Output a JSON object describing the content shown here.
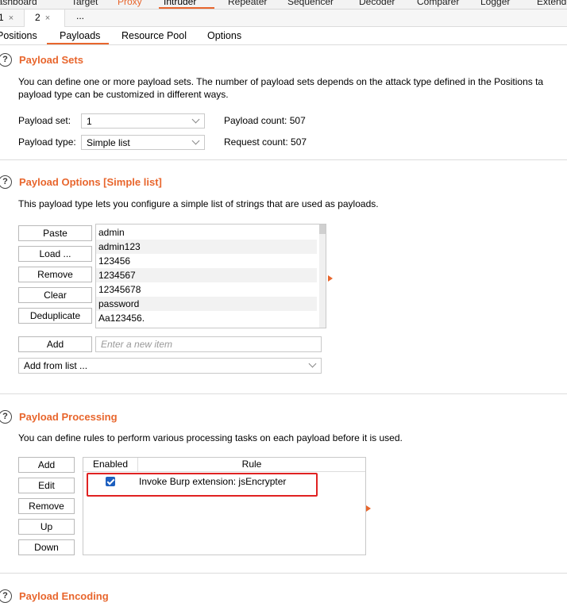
{
  "tool_tabs": {
    "items": [
      "Dashboard",
      "Target",
      "Proxy",
      "Intruder",
      "Repeater",
      "Sequencer",
      "Decoder",
      "Comparer",
      "Logger",
      "Extender"
    ],
    "active": "Intruder"
  },
  "instance_tabs": {
    "items": [
      {
        "label": "1",
        "close": "×"
      },
      {
        "label": "2",
        "close": "×"
      },
      {
        "label": "..."
      }
    ]
  },
  "sub_tabs": {
    "items": [
      "Positions",
      "Payloads",
      "Resource Pool",
      "Options"
    ],
    "active": "Payloads"
  },
  "help_glyph": "?",
  "payload_sets": {
    "title": "Payload Sets",
    "desc_line1": "You can define one or more payload sets. The number of payload sets depends on the attack type defined in the Positions ta",
    "desc_line2": "payload type can be customized in different ways.",
    "set_label": "Payload set:",
    "set_value": "1",
    "type_label": "Payload type:",
    "type_value": "Simple list",
    "payload_count": "Payload count: 507",
    "request_count": "Request count: 507"
  },
  "payload_options": {
    "title": "Payload Options [Simple list]",
    "desc": "This payload type lets you configure a simple list of strings that are used as payloads.",
    "buttons": [
      "Paste",
      "Load ...",
      "Remove",
      "Clear",
      "Deduplicate"
    ],
    "items": [
      "admin",
      "admin123",
      "123456",
      "1234567",
      "12345678",
      "password",
      "Aa123456."
    ],
    "add_button": "Add",
    "add_placeholder": "Enter a new item",
    "add_from_list": "Add from list ..."
  },
  "payload_processing": {
    "title": "Payload Processing",
    "desc": "You can define rules to perform various processing tasks on each payload before it is used.",
    "buttons": [
      "Add",
      "Edit",
      "Remove",
      "Up",
      "Down"
    ],
    "columns": [
      "Enabled",
      "Rule"
    ],
    "rows": [
      {
        "enabled": true,
        "rule": "Invoke Burp extension: jsEncrypter"
      }
    ]
  },
  "payload_encoding": {
    "title": "Payload Encoding"
  },
  "colors": {
    "accent": "#e8662d",
    "highlight_box": "#e02222",
    "checkbox": "#1d5fbf"
  }
}
